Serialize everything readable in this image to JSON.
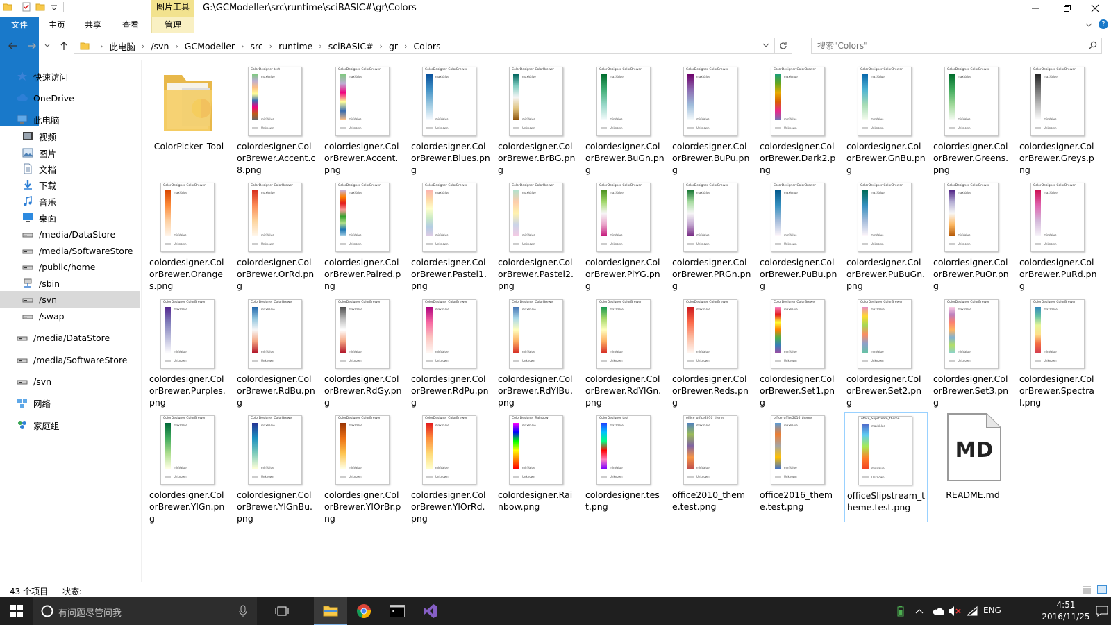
{
  "window": {
    "context_tab_group": "图片工具",
    "title": "G:\\GCModeller\\src\\runtime\\sciBASIC#\\gr\\Colors"
  },
  "ribbon": {
    "tabs": [
      "文件",
      "主页",
      "共享",
      "查看",
      "管理"
    ]
  },
  "address": {
    "crumbs": [
      "此电脑",
      "/svn",
      "GCModeller",
      "src",
      "runtime",
      "sciBASIC#",
      "gr",
      "Colors"
    ],
    "search_placeholder": "搜索\"Colors\""
  },
  "navpane": {
    "items": [
      {
        "label": "快速访问",
        "icon": "star-icon",
        "level": 0
      },
      {
        "label": "OneDrive",
        "icon": "cloud-icon",
        "level": 0
      },
      {
        "label": "此电脑",
        "icon": "computer-icon",
        "level": 0
      },
      {
        "label": "视频",
        "icon": "video-icon",
        "level": 1
      },
      {
        "label": "图片",
        "icon": "picture-icon",
        "level": 1
      },
      {
        "label": "文档",
        "icon": "document-icon",
        "level": 1
      },
      {
        "label": "下载",
        "icon": "download-icon",
        "level": 1
      },
      {
        "label": "音乐",
        "icon": "music-icon",
        "level": 1
      },
      {
        "label": "桌面",
        "icon": "desktop-icon",
        "level": 1
      },
      {
        "label": "/media/DataStore",
        "icon": "drive-icon",
        "level": 1
      },
      {
        "label": "/media/SoftwareStore",
        "icon": "drive-icon",
        "level": 1
      },
      {
        "label": "/public/home",
        "icon": "drive-icon",
        "level": 1
      },
      {
        "label": "/sbin",
        "icon": "network-drive-icon",
        "level": 1
      },
      {
        "label": "/svn",
        "icon": "drive-icon",
        "level": 1,
        "selected": true
      },
      {
        "label": "/swap",
        "icon": "drive-icon",
        "level": 1
      },
      {
        "label": "/media/DataStore",
        "icon": "drive-icon",
        "level": 0
      },
      {
        "label": "/media/SoftwareStore",
        "icon": "drive-icon",
        "level": 0
      },
      {
        "label": "/svn",
        "icon": "drive-icon",
        "level": 0
      },
      {
        "label": "网络",
        "icon": "network-icon",
        "level": 0
      },
      {
        "label": "家庭组",
        "icon": "homegroup-icon",
        "level": 0
      }
    ]
  },
  "files": [
    {
      "name": "ColorPicker_Tool",
      "kind": "folder"
    },
    {
      "name": "colordesigner.ColorBrewer.Accent.c8.png",
      "kind": "png",
      "header": "ColorDesigner test",
      "colors": [
        "#7fc97f",
        "#beaed4",
        "#fdc086",
        "#ffff99",
        "#386cb0",
        "#f0027f",
        "#bf5b17",
        "#666666"
      ]
    },
    {
      "name": "colordesigner.ColorBrewer.Accent.png",
      "kind": "png",
      "header": "ColorDesigner ColorBrewer",
      "colors": [
        "#7fc97f",
        "#beaed4",
        "#f0027f",
        "#ffff99",
        "#386cb0",
        "#fdc086"
      ]
    },
    {
      "name": "colordesigner.ColorBrewer.Blues.png",
      "kind": "png",
      "header": "ColorDesigner ColorBrewer",
      "colors": [
        "#08519c",
        "#4292c6",
        "#9ecae1",
        "#f7fbff"
      ]
    },
    {
      "name": "colordesigner.ColorBrewer.BrBG.png",
      "kind": "png",
      "header": "ColorDesigner ColorBrewer",
      "colors": [
        "#01665e",
        "#80cdc1",
        "#f5f5f5",
        "#dfc27d",
        "#8c510a"
      ]
    },
    {
      "name": "colordesigner.ColorBrewer.BuGn.png",
      "kind": "png",
      "header": "ColorDesigner ColorBrewer",
      "colors": [
        "#006d2c",
        "#41ae76",
        "#99d8c9",
        "#f7fcfd"
      ]
    },
    {
      "name": "colordesigner.ColorBrewer.BuPu.png",
      "kind": "png",
      "header": "ColorDesigner ColorBrewer",
      "colors": [
        "#6e016b",
        "#8c6bb1",
        "#9ebcda",
        "#f7fcfd"
      ]
    },
    {
      "name": "colordesigner.ColorBrewer.Dark2.png",
      "kind": "png",
      "header": "ColorDesigner ColorBrewer",
      "colors": [
        "#1b9e77",
        "#66a61e",
        "#e6ab02",
        "#d95f02",
        "#e7298a",
        "#7570b3"
      ]
    },
    {
      "name": "colordesigner.ColorBrewer.GnBu.png",
      "kind": "png",
      "header": "ColorDesigner ColorBrewer",
      "colors": [
        "#0868ac",
        "#4eb3d3",
        "#a8ddb5",
        "#f7fcf0"
      ]
    },
    {
      "name": "colordesigner.ColorBrewer.Greens.png",
      "kind": "png",
      "header": "ColorDesigner ColorBrewer",
      "colors": [
        "#006d2c",
        "#41ab5d",
        "#a1d99b",
        "#f7fcf5"
      ]
    },
    {
      "name": "colordesigner.ColorBrewer.Greys.png",
      "kind": "png",
      "header": "ColorDesigner ColorBrewer",
      "colors": [
        "#252525",
        "#737373",
        "#bdbdbd",
        "#ffffff"
      ]
    },
    {
      "name": "colordesigner.ColorBrewer.Oranges.png",
      "kind": "png",
      "header": "ColorDesigner ColorBrewer",
      "colors": [
        "#d94801",
        "#fd8d3c",
        "#fdd0a2",
        "#fff5eb"
      ]
    },
    {
      "name": "colordesigner.ColorBrewer.OrRd.png",
      "kind": "png",
      "header": "ColorDesigner ColorBrewer",
      "colors": [
        "#d7301f",
        "#fc8d59",
        "#fdd49e",
        "#fff7ec"
      ]
    },
    {
      "name": "colordesigner.ColorBrewer.Paired.png",
      "kind": "png",
      "header": "ColorDesigner ColorBrewer",
      "colors": [
        "#cab2d6",
        "#ff7f00",
        "#e31a1c",
        "#fb9a99",
        "#33a02c",
        "#b2df8a",
        "#1f78b4",
        "#a6cee3"
      ]
    },
    {
      "name": "colordesigner.ColorBrewer.Pastel1.png",
      "kind": "png",
      "header": "ColorDesigner ColorBrewer",
      "colors": [
        "#fbb4ae",
        "#fed9a6",
        "#ffffcc",
        "#ccebc5",
        "#b3cde3",
        "#decbe4"
      ]
    },
    {
      "name": "colordesigner.ColorBrewer.Pastel2.png",
      "kind": "png",
      "header": "ColorDesigner ColorBrewer",
      "colors": [
        "#b3e2cd",
        "#fdcdac",
        "#fff2ae",
        "#cbd5e8",
        "#f4cae4"
      ]
    },
    {
      "name": "colordesigner.ColorBrewer.PiYG.png",
      "kind": "png",
      "header": "ColorDesigner ColorBrewer",
      "colors": [
        "#4d9221",
        "#a1d76a",
        "#f7f7f7",
        "#e9a3c9",
        "#c51b7d"
      ]
    },
    {
      "name": "colordesigner.ColorBrewer.PRGn.png",
      "kind": "png",
      "header": "ColorDesigner ColorBrewer",
      "colors": [
        "#1b7837",
        "#a6dba0",
        "#f7f7f7",
        "#c2a5cf",
        "#762a83"
      ]
    },
    {
      "name": "colordesigner.ColorBrewer.PuBu.png",
      "kind": "png",
      "header": "ColorDesigner ColorBrewer",
      "colors": [
        "#045a8d",
        "#3690c0",
        "#a6bddb",
        "#fff7fb"
      ]
    },
    {
      "name": "colordesigner.ColorBrewer.PuBuGn.png",
      "kind": "png",
      "header": "ColorDesigner ColorBrewer",
      "colors": [
        "#016c59",
        "#3690c0",
        "#a6bddb",
        "#fff7fb"
      ]
    },
    {
      "name": "colordesigner.ColorBrewer.PuOr.png",
      "kind": "png",
      "header": "ColorDesigner ColorBrewer",
      "colors": [
        "#542788",
        "#b2abd2",
        "#f7f7f7",
        "#fdb863",
        "#b35806"
      ]
    },
    {
      "name": "colordesigner.ColorBrewer.PuRd.png",
      "kind": "png",
      "header": "ColorDesigner ColorBrewer",
      "colors": [
        "#ce1256",
        "#df65b0",
        "#d4b9da",
        "#f7f4f9"
      ]
    },
    {
      "name": "colordesigner.ColorBrewer.Purples.png",
      "kind": "png",
      "header": "ColorDesigner ColorBrewer",
      "colors": [
        "#54278f",
        "#807dba",
        "#bcbddc",
        "#fcfbfd"
      ]
    },
    {
      "name": "colordesigner.ColorBrewer.RdBu.png",
      "kind": "png",
      "header": "ColorDesigner ColorBrewer",
      "colors": [
        "#2166ac",
        "#92c5de",
        "#f7f7f7",
        "#f4a582",
        "#b2182b"
      ]
    },
    {
      "name": "colordesigner.ColorBrewer.RdGy.png",
      "kind": "png",
      "header": "ColorDesigner ColorBrewer",
      "colors": [
        "#4d4d4d",
        "#bababa",
        "#ffffff",
        "#f4a582",
        "#b2182b"
      ]
    },
    {
      "name": "colordesigner.ColorBrewer.RdPu.png",
      "kind": "png",
      "header": "ColorDesigner ColorBrewer",
      "colors": [
        "#ae017e",
        "#f768a1",
        "#fcc5c0",
        "#fff7f3"
      ]
    },
    {
      "name": "colordesigner.ColorBrewer.RdYlBu.png",
      "kind": "png",
      "header": "ColorDesigner ColorBrewer",
      "colors": [
        "#4575b4",
        "#abd9e9",
        "#ffffbf",
        "#fdae61",
        "#d73027"
      ]
    },
    {
      "name": "colordesigner.ColorBrewer.RdYlGn.png",
      "kind": "png",
      "header": "ColorDesigner ColorBrewer",
      "colors": [
        "#1a9850",
        "#a6d96a",
        "#ffffbf",
        "#fdae61",
        "#d73027"
      ]
    },
    {
      "name": "colordesigner.ColorBrewer.Reds.png",
      "kind": "png",
      "header": "ColorDesigner ColorBrewer",
      "colors": [
        "#cb181d",
        "#fb6a4a",
        "#fcbba1",
        "#fff5f0"
      ]
    },
    {
      "name": "colordesigner.ColorBrewer.Set1.png",
      "kind": "png",
      "header": "ColorDesigner ColorBrewer",
      "colors": [
        "#f781bf",
        "#e41a1c",
        "#ffff33",
        "#ff7f00",
        "#4daf4a",
        "#377eb8",
        "#984ea3"
      ]
    },
    {
      "name": "colordesigner.ColorBrewer.Set2.png",
      "kind": "png",
      "header": "ColorDesigner ColorBrewer",
      "colors": [
        "#e78ac3",
        "#ffd92f",
        "#a6d854",
        "#fc8d62",
        "#8da0cb",
        "#66c2a5"
      ]
    },
    {
      "name": "colordesigner.ColorBrewer.Set3.png",
      "kind": "png",
      "header": "ColorDesigner ColorBrewer",
      "colors": [
        "#fccde5",
        "#bc80bd",
        "#fb8072",
        "#fdb462",
        "#80b1d3",
        "#b3de69",
        "#8dd3c7"
      ]
    },
    {
      "name": "colordesigner.ColorBrewer.Spectral.png",
      "kind": "png",
      "header": "ColorDesigner ColorBrewer",
      "colors": [
        "#3288bd",
        "#66c2a5",
        "#e6f598",
        "#fee08b",
        "#f46d43",
        "#d53e4f"
      ]
    },
    {
      "name": "colordesigner.ColorBrewer.YlGn.png",
      "kind": "png",
      "header": "ColorDesigner ColorBrewer",
      "colors": [
        "#006837",
        "#41ab5d",
        "#addd8e",
        "#ffffe5"
      ]
    },
    {
      "name": "colordesigner.ColorBrewer.YlGnBu.png",
      "kind": "png",
      "header": "ColorDesigner ColorBrewer",
      "colors": [
        "#253494",
        "#1d91c0",
        "#7fcdbb",
        "#ffffd9"
      ]
    },
    {
      "name": "colordesigner.ColorBrewer.YlOrBr.png",
      "kind": "png",
      "header": "ColorDesigner ColorBrewer",
      "colors": [
        "#993404",
        "#ec7014",
        "#fec44f",
        "#ffffe5"
      ]
    },
    {
      "name": "colordesigner.ColorBrewer.YlOrRd.png",
      "kind": "png",
      "header": "ColorDesigner ColorBrewer",
      "colors": [
        "#e31a1c",
        "#fd8d3c",
        "#fed976",
        "#ffffcc"
      ]
    },
    {
      "name": "colordesigner.Rainbow.png",
      "kind": "png",
      "header": "ColorDesigner Rainbow",
      "colors": [
        "#ff00ff",
        "#0000ff",
        "#00ff00",
        "#ffff00",
        "#ff7f00",
        "#ff0000"
      ]
    },
    {
      "name": "colordesigner.test.png",
      "kind": "png",
      "header": "ColorDesigner test",
      "colors": [
        "#1f3fff",
        "#00c0ff",
        "#00ff80",
        "#ff0000",
        "#ff80c0",
        "#8000ff"
      ]
    },
    {
      "name": "office2010_theme.test.png",
      "kind": "png",
      "header": "office_office2010_theme",
      "colors": [
        "#4f81bd",
        "#9bbb59",
        "#8064a2",
        "#f79646",
        "#c0504d"
      ]
    },
    {
      "name": "office2016_theme.test.png",
      "kind": "png",
      "header": "office_office2016_theme",
      "colors": [
        "#5b9bd5",
        "#ed7d31",
        "#a5a5a5",
        "#ffc000",
        "#4472c4"
      ]
    },
    {
      "name": "officeSlipstream_theme.test.png",
      "kind": "png",
      "header": "office_Slipstream_theme",
      "colors": [
        "#4e67c8",
        "#5eccf3",
        "#a7ea52",
        "#ff7f2a",
        "#f14124"
      ],
      "selected": true
    },
    {
      "name": "README.md",
      "kind": "md"
    }
  ],
  "thumb_labels": {
    "max": "maxValue",
    "min": "minValue",
    "unknown": "Unknown"
  },
  "statusbar": {
    "count": "43 个项目",
    "state": "状态:"
  },
  "taskbar": {
    "search_placeholder": "有问题尽管问我",
    "lang": "ENG",
    "time": "4:51",
    "date": "2016/11/25"
  }
}
